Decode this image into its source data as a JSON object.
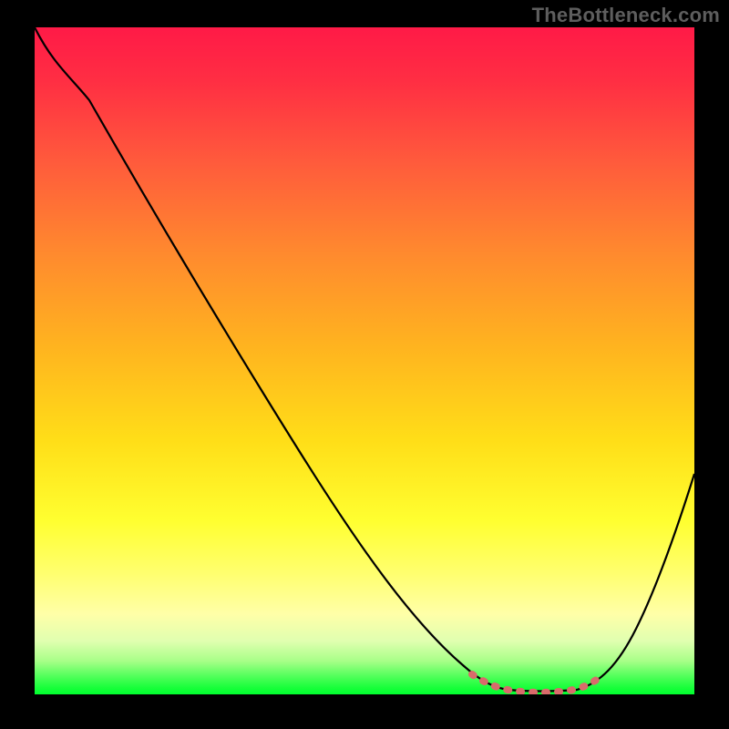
{
  "watermark": "TheBottleneck.com",
  "chart_data": {
    "type": "line",
    "title": "",
    "xlabel": "",
    "ylabel": "",
    "xlim": [
      0,
      100
    ],
    "ylim": [
      0,
      100
    ],
    "series": [
      {
        "name": "bottleneck-curve",
        "x": [
          0,
          4,
          10,
          18,
          26,
          34,
          42,
          50,
          58,
          64,
          68,
          72,
          76,
          80,
          84,
          88,
          92,
          96,
          100
        ],
        "y": [
          100,
          96,
          90,
          80,
          70,
          60,
          50,
          40,
          28,
          16,
          8,
          3,
          1,
          0.5,
          1,
          4,
          12,
          24,
          38
        ]
      },
      {
        "name": "optimal-range-marker",
        "x": [
          68,
          70,
          72,
          74,
          76,
          78,
          80,
          82,
          84
        ],
        "y": [
          3,
          1.8,
          1.2,
          0.9,
          0.8,
          0.9,
          1.2,
          1.8,
          3
        ]
      }
    ],
    "colors": {
      "curve": "#000000",
      "marker": "#d96b6b",
      "gradient_top": "#ff1a47",
      "gradient_bottom": "#00ff2f"
    }
  }
}
